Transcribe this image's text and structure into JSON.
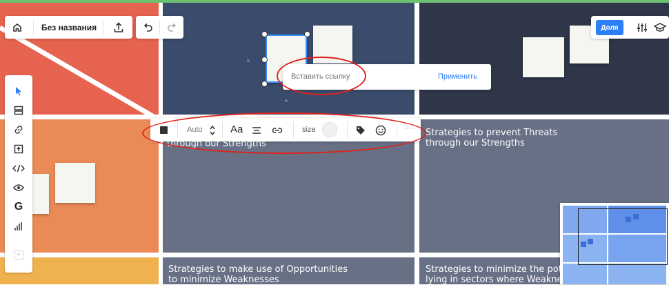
{
  "board": {
    "title": "Без названия",
    "cells": [
      {
        "text_1": "through our Strengths"
      },
      {
        "text_1": "Strategies to prevent Threats",
        "text_2": "through our Strengths"
      },
      {
        "text_1": "Strategies to make use of Opportunities",
        "text_2": "to minimize Weaknesses"
      },
      {
        "text_1": "Strategies to minimize the pote",
        "text_2": "lying in sectors where Weaknes"
      }
    ]
  },
  "link_popup": {
    "placeholder": "Вставить ссылку",
    "apply_label": "Применить"
  },
  "format_toolbar": {
    "auto_label": "Auto",
    "font_label": "Aa",
    "size_label": "size",
    "more_label": "···"
  },
  "top_right": {
    "share_label": "Доля"
  },
  "colors": {
    "accent": "#2d7ff9",
    "annotation": "#e0221b",
    "red_cell": "#e6634f",
    "orange_cell": "#ea8b57",
    "yellow_cell": "#f0b24f",
    "navy_cell": "#3b4b6b",
    "dark_cell": "#2e3648",
    "slate_cell": "#687086"
  },
  "icons": [
    "home-icon",
    "upload-icon",
    "undo-icon",
    "redo-icon",
    "settings-sliders-icon",
    "graduation-cap-icon",
    "cursor-icon",
    "frame-icon",
    "link-icon",
    "upload-board-icon",
    "embed-code-icon",
    "eye-icon",
    "google-icon",
    "chart-icon",
    "add-icon",
    "sticky-color-icon",
    "chevron-updown-icon",
    "align-icon",
    "tag-icon",
    "emoji-icon"
  ]
}
